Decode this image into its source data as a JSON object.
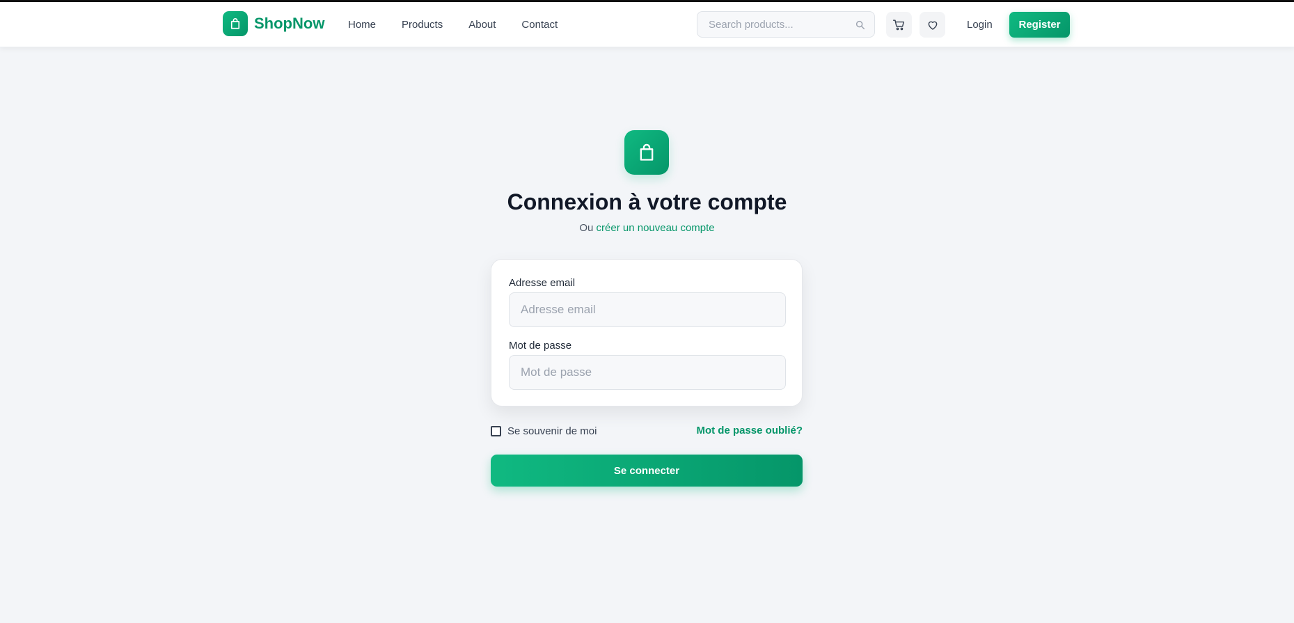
{
  "colors": {
    "brand": "#10b981",
    "brand_dark": "#059669",
    "background": "#f3f5f8"
  },
  "navbar": {
    "brand_name": "ShopNow",
    "brand_icon": "shopping-bag-icon",
    "links": [
      "Home",
      "Products",
      "About",
      "Contact"
    ],
    "search": {
      "placeholder": "Search products..."
    },
    "cart_icon": "cart-icon",
    "wishlist_icon": "heart-icon",
    "login_label": "Login",
    "register_label": "Register"
  },
  "hero": {
    "icon": "shopping-bag-icon",
    "title": "Connexion à votre compte",
    "subtitle_prefix": "Ou ",
    "subtitle_link": "créer un nouveau compte"
  },
  "form": {
    "email_label": "Adresse email",
    "email_placeholder": "Adresse email",
    "email_value": "",
    "password_label": "Mot de passe",
    "password_placeholder": "Mot de passe",
    "password_value": "",
    "remember_label": "Se souvenir de moi",
    "remember_checked": false,
    "forgot_label": "Mot de passe oublié?",
    "submit_label": "Se connecter"
  }
}
